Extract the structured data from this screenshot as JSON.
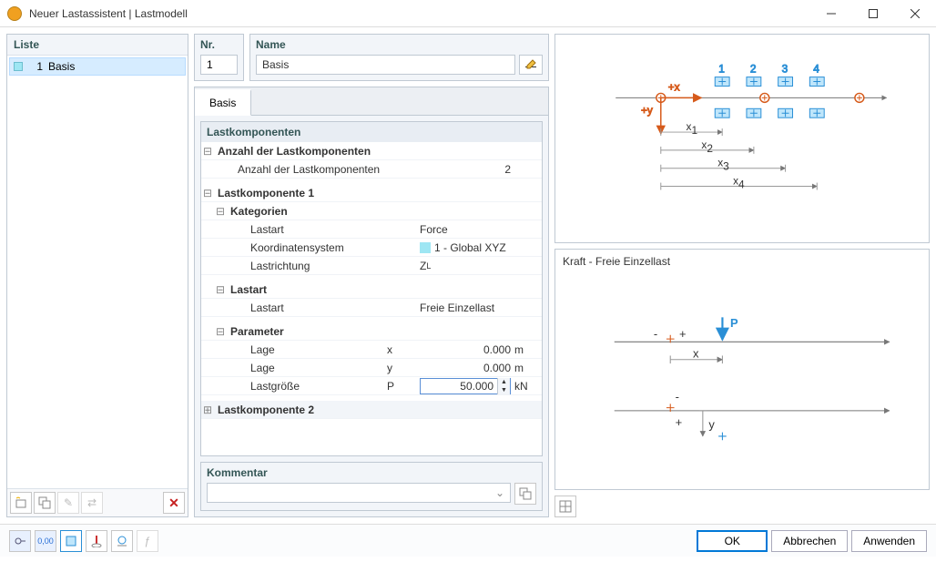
{
  "window": {
    "title": "Neuer Lastassistent | Lastmodell"
  },
  "left": {
    "header": "Liste",
    "items": [
      {
        "num": "1",
        "label": "Basis"
      }
    ]
  },
  "nr": {
    "label": "Nr.",
    "value": "1"
  },
  "name": {
    "label": "Name",
    "value": "Basis"
  },
  "tabs": {
    "active": "Basis"
  },
  "tree": {
    "section": "Lastkomponenten",
    "count_label": "Anzahl der Lastkomponenten",
    "count_value": "2",
    "comp1_label": "Lastkomponente 1",
    "kategorien_label": "Kategorien",
    "lastart_label": "Lastart",
    "lastart_value": "Force",
    "koord_label": "Koordinatensystem",
    "koord_value": "1 - Global XYZ",
    "lastrichtung_label": "Lastrichtung",
    "lastrichtung_value": "Z",
    "lastrichtung_sub": "L",
    "lastart2_hdr": "Lastart",
    "lastart2_label": "Lastart",
    "lastart2_value": "Freie Einzellast",
    "param_label": "Parameter",
    "lage_label": "Lage",
    "lage_x_sym": "x",
    "lage_x_val": "0.000",
    "lage_x_unit": "m",
    "lage_y_sym": "y",
    "lage_y_val": "0.000",
    "lage_y_unit": "m",
    "lastgroesse_label": "Lastgröße",
    "lastgroesse_sym": "P",
    "lastgroesse_val": "50.000",
    "lastgroesse_unit": "kN",
    "comp2_label": "Lastkomponente 2"
  },
  "kommentar": {
    "label": "Kommentar"
  },
  "right": {
    "subtitle": "Kraft - Freie Einzellast",
    "diagram_labels": {
      "n1": "1",
      "n2": "2",
      "n3": "3",
      "n4": "4",
      "px": "+x",
      "py": "+y",
      "x1": "x",
      "x1s": "1",
      "x2": "x",
      "x2s": "2",
      "x3": "x",
      "x3s": "3",
      "x4": "x",
      "x4s": "4",
      "P": "P",
      "xlab": "x",
      "ylab": "y",
      "plus": "+",
      "minus": "-"
    }
  },
  "footer": {
    "ok": "OK",
    "cancel": "Abbrechen",
    "apply": "Anwenden"
  }
}
